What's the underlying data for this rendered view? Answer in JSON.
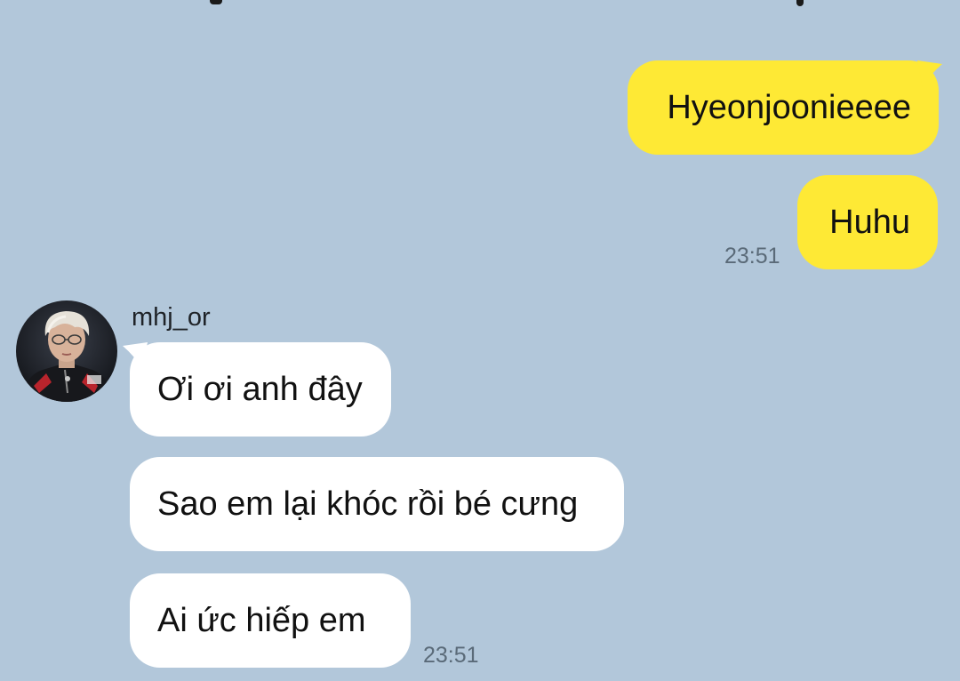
{
  "chat": {
    "background_color": "#b2c7da",
    "outgoing_color": "#fee935",
    "incoming_color": "#ffffff",
    "outgoing": {
      "messages": [
        "Hyeonjoonieeee",
        "Huhu"
      ],
      "time": "23:51"
    },
    "incoming": {
      "sender": "mhj_or",
      "avatar_icon": "profile-photo",
      "messages": [
        "Ơi ơi anh đây",
        "Sao em lại khóc rồi bé cưng",
        "Ai ức hiếp em"
      ],
      "time": "23:51"
    }
  }
}
